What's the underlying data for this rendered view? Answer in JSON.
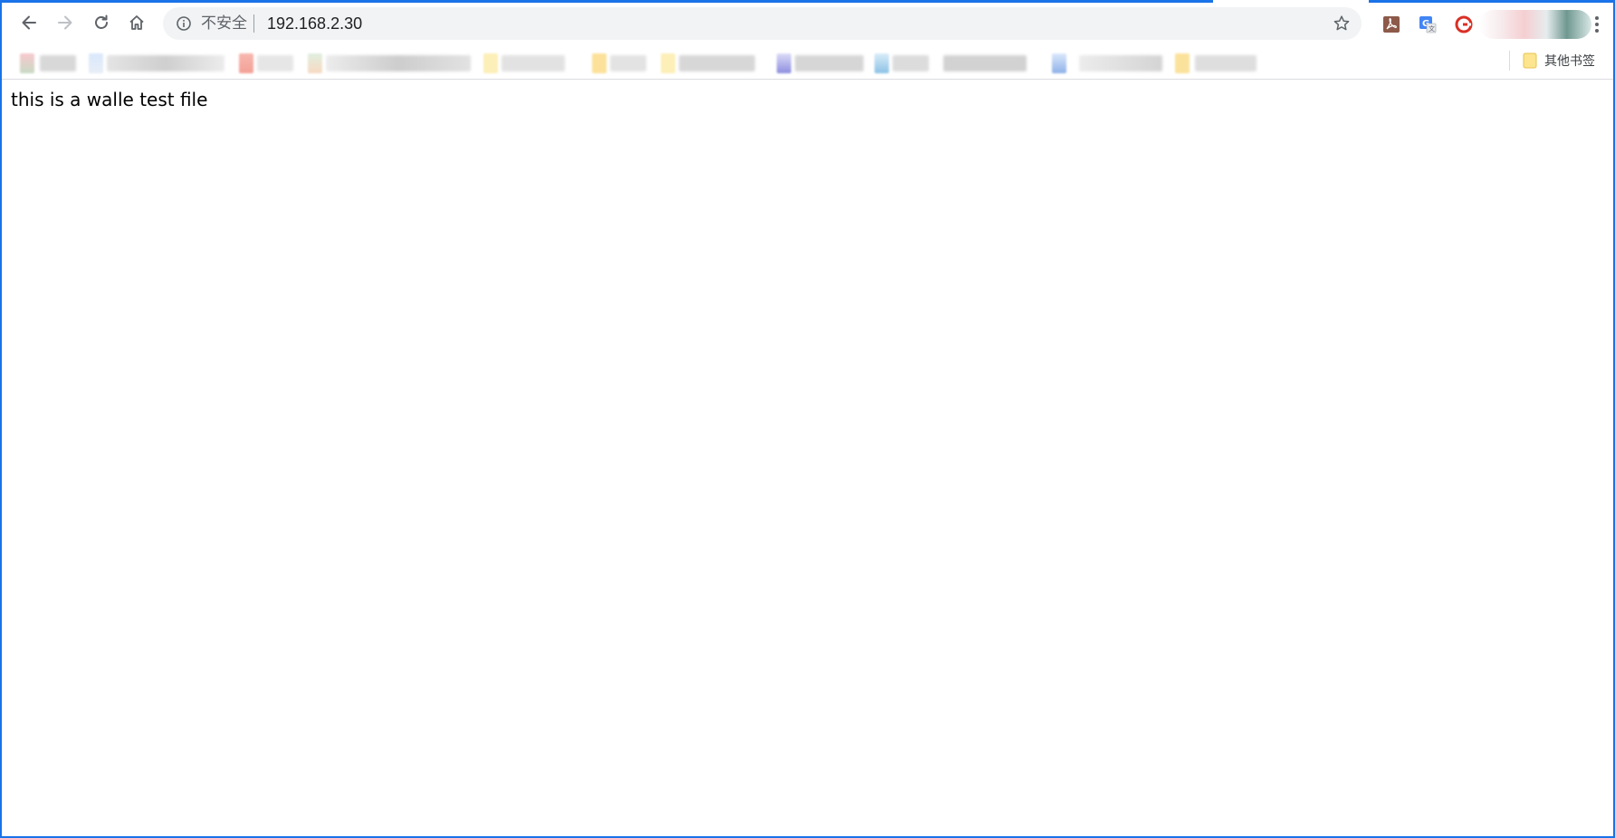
{
  "browser": {
    "address_bar": {
      "security_label": "不安全",
      "url": "192.168.2.30"
    },
    "nav": {
      "back": "back-arrow-icon",
      "forward": "forward-arrow-icon",
      "reload": "reload-icon",
      "home": "home-icon"
    },
    "extensions": [
      "pdf-extension-icon",
      "translate-extension-icon",
      "grammar-extension-icon"
    ],
    "bookmarks_bar": {
      "other_bookmarks_label": "其他书签"
    },
    "colors": {
      "accent": "#1a73e8",
      "omnibox_bg": "#f1f3f4",
      "icon_gray": "#5f6368"
    }
  },
  "page": {
    "body_text": "this is a walle test file"
  }
}
